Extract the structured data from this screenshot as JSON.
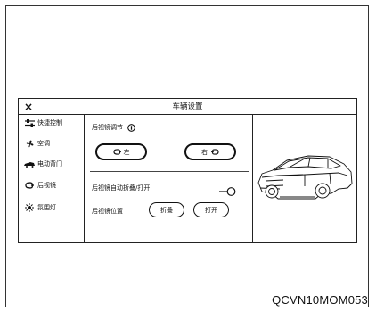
{
  "window": {
    "title": "车辆设置",
    "close_glyph": "×"
  },
  "sidebar": {
    "items": [
      {
        "icon": "sliders-icon",
        "label": "快捷控制"
      },
      {
        "icon": "fan-icon",
        "label": "空调"
      },
      {
        "icon": "car-door-icon",
        "label": "电动背门"
      },
      {
        "icon": "mirror-icon",
        "label": "后视镜"
      },
      {
        "icon": "ambient-light-icon",
        "label": "氛围灯"
      }
    ]
  },
  "mirror_adjust": {
    "label": "后视镜调节",
    "info_icon": "info-icon",
    "left_button": "左",
    "right_button": "右"
  },
  "auto_fold": {
    "label": "后视镜自动折叠/打开",
    "toggle_on": true
  },
  "mirror_position": {
    "label": "后视镜位置",
    "fold_button": "折叠",
    "open_button": "打开"
  },
  "car_image": {
    "icon": "car-illustration"
  },
  "caption": "QCVN10MOM053"
}
